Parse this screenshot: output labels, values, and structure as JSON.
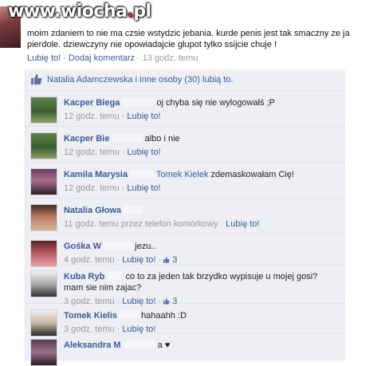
{
  "watermark": {
    "pre": "www.wiocha",
    "dot": ".",
    "post": "pl"
  },
  "post": {
    "text": "moim zdaniem to nie ma czsie wstydzic jebania. kurde penis jest tak smaczny ze ja pierdole. dziewczyny nie opowiadajcie glupot tylko ssijcie chuje !",
    "like_label": "Lubię to!",
    "comment_label": "Dodaj komentarz",
    "sep": "·",
    "time": "13 godz. temu"
  },
  "likes": {
    "text": "Natalia Adamczewska i inne osoby (30) lubią to."
  },
  "comments": [
    {
      "name": "Kacper Biega",
      "text": "oj chyba się nie wylogowałś ;P",
      "time": "12 godz. temu",
      "like": "Lubię to!"
    },
    {
      "name": "Kacper Bie",
      "text": "albo i nie",
      "time": "12 godz. temu",
      "like": "Lubię to!"
    },
    {
      "name": "Kamila Marysia",
      "tag": "Tomek Kielek",
      "text": "zdemaskowałam Cię!",
      "time": "12 godz. temu",
      "like": "Lubię to!"
    },
    {
      "name": "Natalia Głowa",
      "text": "",
      "time": "11 godz. temu przez telefon komórkowy",
      "like": "Lubię to!"
    },
    {
      "name": "Gośka W",
      "text": "jezu..",
      "time": "4 godz. temu",
      "like": "Lubię to!",
      "likes": "3"
    },
    {
      "name": "Kuba Ryb",
      "text": "co to za jeden tak brzydko wypisuje u mojej gosi? mam sie nim zajac?",
      "time": "3 godz. temu",
      "like": "Lubię to!",
      "likes": "3"
    },
    {
      "name": "Tomek Kielis",
      "text": "hahaahh :D",
      "time": "3 godz. temu",
      "like": "Lubię to!"
    },
    {
      "name": "Aleksandra M",
      "text": "a ♥",
      "time": "",
      "like": ""
    }
  ],
  "colors": {
    "link": "#3b5998",
    "panel": "#edeff4",
    "meta": "#999999"
  }
}
